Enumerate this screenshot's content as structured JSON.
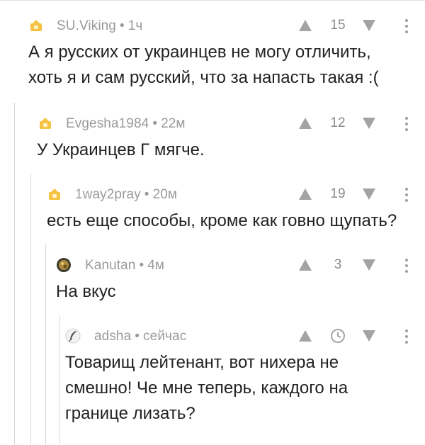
{
  "comments": [
    {
      "author": "SU.Viking",
      "time": "1ч",
      "score": "15",
      "avatar_icon": "default-avatar-icon",
      "lines": [
        "А я русских от украинцев не могу отличить,",
        "хоть я и сам русский, что за напасть такая :("
      ]
    },
    {
      "author": "Evgesha1984",
      "time": "22м",
      "score": "12",
      "avatar_icon": "default-avatar-icon",
      "lines": [
        "У Украинцев Г мягче."
      ]
    },
    {
      "author": "1way2pray",
      "time": "20м",
      "score": "19",
      "avatar_icon": "default-avatar-icon",
      "lines": [
        "есть еще способы, кроме как говно щупать?"
      ]
    },
    {
      "author": "Kanutan",
      "time": "4м",
      "score": "3",
      "avatar_icon": "user-photo-avatar",
      "lines": [
        "На вкус"
      ]
    },
    {
      "author": "adsha",
      "time": "сейчас",
      "score": "",
      "avatar_icon": "quill-avatar-icon",
      "pending_icon": "clock-icon",
      "lines": [
        "Товарищ лейтенант, вот нихера не",
        "смешно! Че мне теперь, каждого на",
        "границе лизать?"
      ]
    }
  ],
  "colors": {
    "text": "#222222",
    "meta": "#9a9a9a",
    "vote_arrow": "#a3a3a3",
    "thread_line": "#d6d6d6",
    "avatar_default": "#f5c242"
  }
}
